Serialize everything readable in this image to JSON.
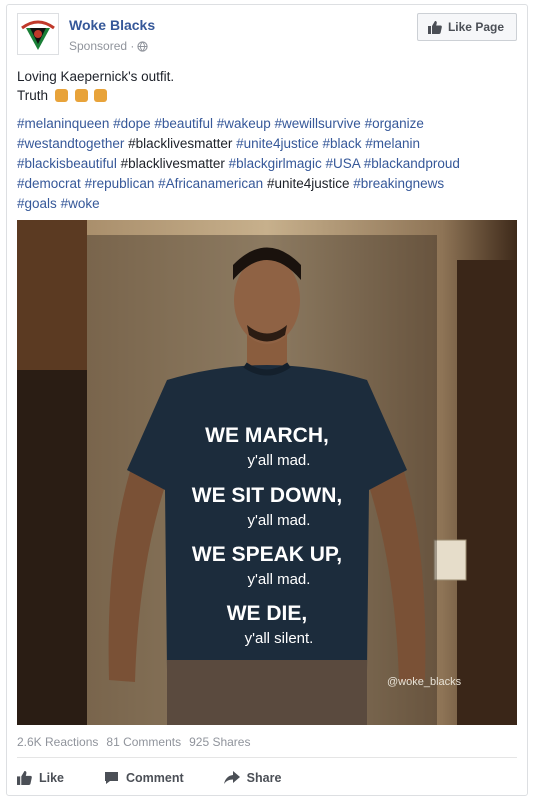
{
  "post": {
    "page_name": "Woke Blacks",
    "sponsored": "Sponsored ·",
    "like_page": "Like Page",
    "text_line1": "Loving Kaepernick's outfit.",
    "text_line2": "Truth",
    "hashtag_lines": [
      [
        "#melaninqueen",
        "#dope",
        "#beautiful",
        "#wakeup",
        "#wewillsurvive",
        "#organize"
      ],
      [
        "#westandtogether",
        "#blacklivesmatter",
        "#unite4justice",
        "#black",
        "#melanin"
      ],
      [
        "#blackisbeautiful",
        "#blacklivesmatter",
        "#blackgirlmagic",
        "#USA",
        "#blackandproud"
      ],
      [
        "#democrat",
        "#republican",
        "#Africanamerican",
        "#unite4justice",
        "#breakingnews"
      ],
      [
        "#goals",
        "#woke"
      ]
    ],
    "plain_tags": [
      "#blacklivesmatter@2",
      "#unite4justice@3"
    ]
  },
  "photo": {
    "shirt_lines": [
      "WE MARCH,",
      "y'all mad.",
      "WE SIT DOWN,",
      "y'all mad.",
      "WE SPEAK UP,",
      "y'all mad.",
      "WE DIE,",
      "y'all silent."
    ],
    "watermark": "@woke_blacks"
  },
  "stats": {
    "reactions": "2.6K Reactions",
    "comments": "81 Comments",
    "shares": "925 Shares"
  },
  "actions": {
    "like": "Like",
    "comment": "Comment",
    "share": "Share"
  },
  "colors": {
    "link": "#365899",
    "muted": "#90949c"
  }
}
